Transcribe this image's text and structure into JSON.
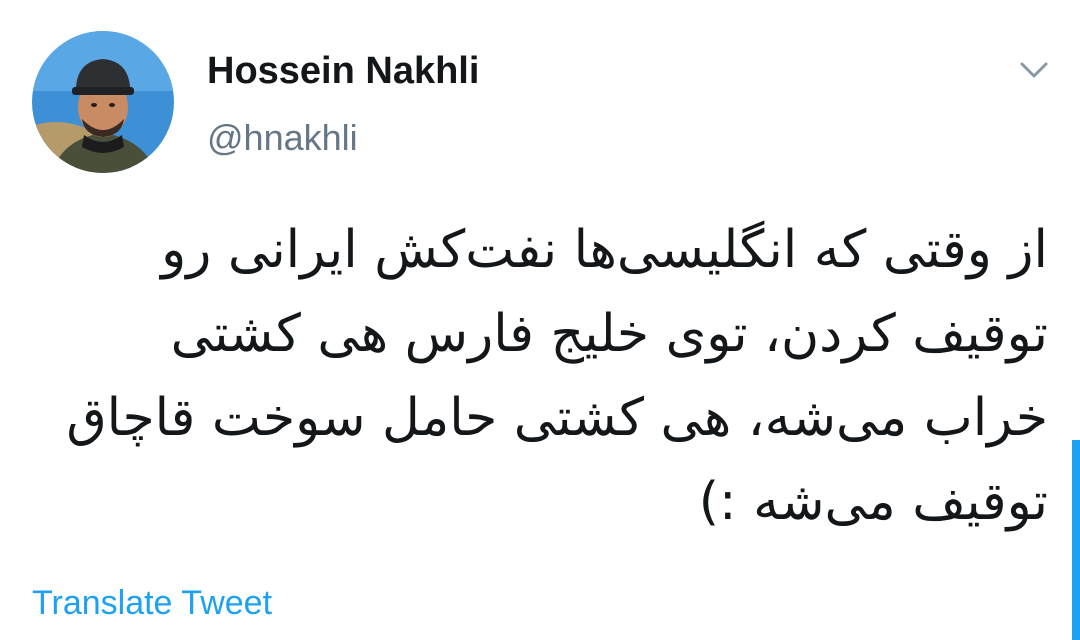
{
  "tweet": {
    "author": {
      "display_name": "Hossein Nakhli",
      "handle": "@hnakhli"
    },
    "text": "از وقتی که انگلیسی‌ها نفت‌کش ایرانی رو توقیف کردن، توی خلیج فارس هی کشتی خراب می‌شه، هی کشتی حامل سوخت قاچاق توقیف می‌شه :)",
    "translate_label": "Translate Tweet"
  },
  "icons": {
    "caret": "chevron-down-icon"
  },
  "colors": {
    "accent": "#1da1f2",
    "text_primary": "#14171a",
    "text_secondary": "#657786"
  }
}
